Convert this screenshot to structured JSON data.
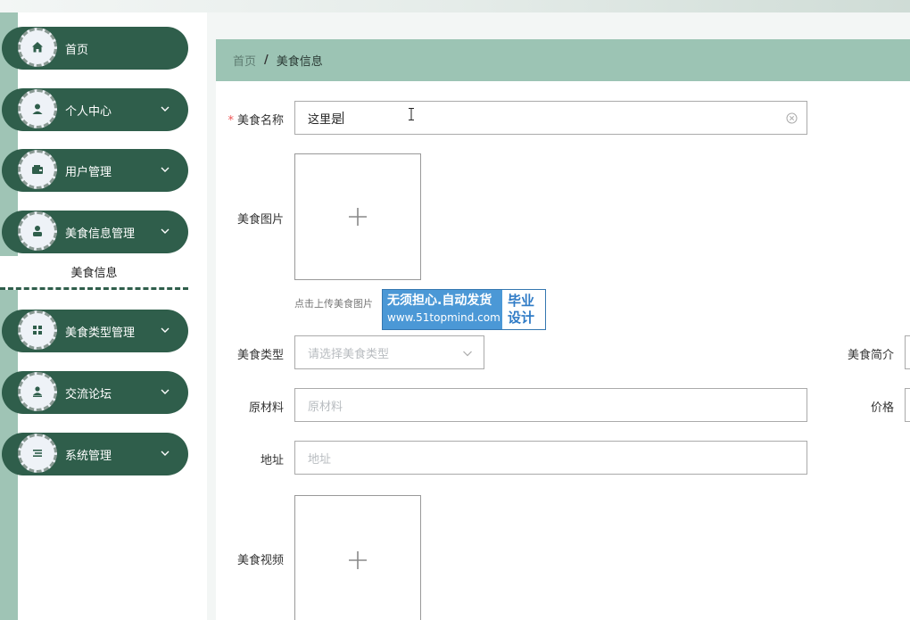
{
  "sidebar": {
    "items": [
      {
        "label": "首页",
        "icon": "home-icon"
      },
      {
        "label": "个人中心",
        "icon": "user-icon"
      },
      {
        "label": "用户管理",
        "icon": "wallet-icon"
      },
      {
        "label": "美食信息管理",
        "icon": "person-icon"
      },
      {
        "label": "美食类型管理",
        "icon": "grid-icon"
      },
      {
        "label": "交流论坛",
        "icon": "forum-user-icon"
      },
      {
        "label": "系统管理",
        "icon": "list-icon"
      }
    ],
    "submenu_active": "美食信息"
  },
  "breadcrumb": {
    "home": "首页",
    "separator": "/",
    "current": "美食信息"
  },
  "form": {
    "name": {
      "required_mark": "*",
      "label": "美食名称",
      "value": "这里是"
    },
    "image": {
      "label": "美食图片",
      "hint": "点击上传美食图片"
    },
    "type": {
      "label": "美食类型",
      "placeholder": "请选择美食类型"
    },
    "intro": {
      "label": "美食简介"
    },
    "ingredients": {
      "label": "原材料",
      "placeholder": "原材料"
    },
    "price": {
      "label": "价格"
    },
    "address": {
      "label": "地址",
      "placeholder": "地址"
    },
    "video": {
      "label": "美食视频"
    }
  },
  "watermark": {
    "line1": "无须担心.自动发货",
    "line2": "www.51topmind.com",
    "right_line1": "毕业",
    "right_line2": "设计"
  },
  "colors": {
    "sidebar_item": "#2f5e4b",
    "breadcrumb_bg": "#9cc4b4",
    "left_strip": "#9fc4b5"
  }
}
